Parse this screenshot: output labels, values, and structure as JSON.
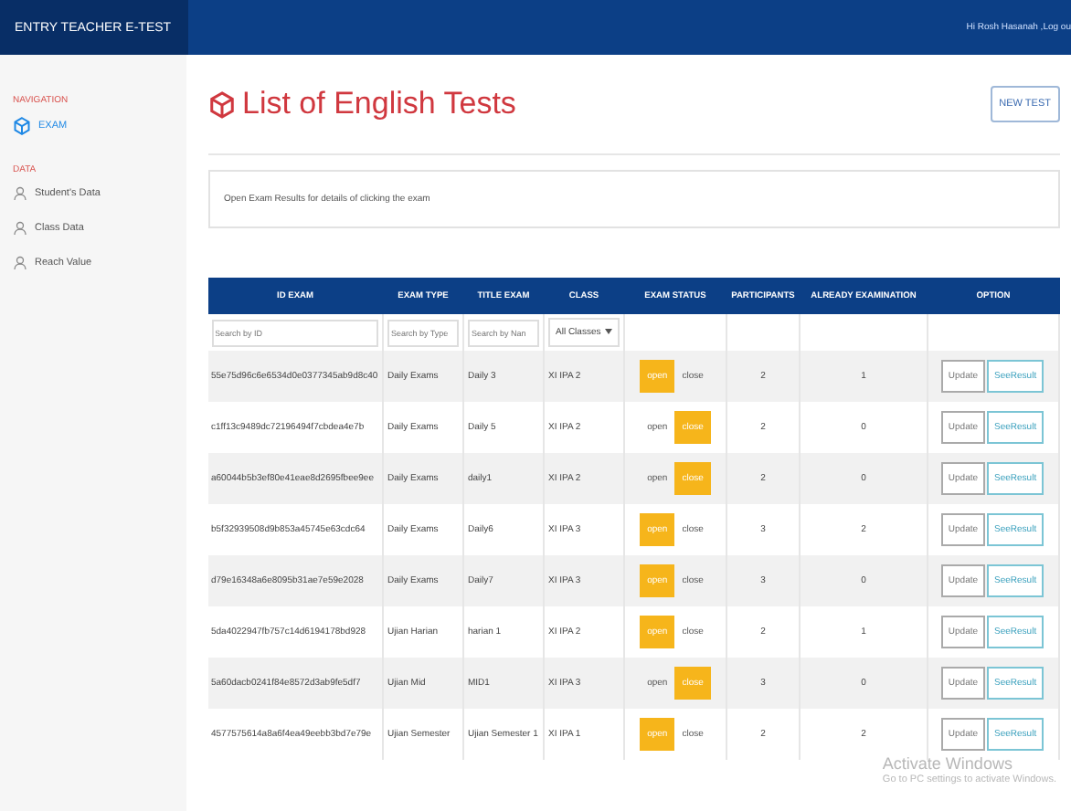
{
  "topbar": {
    "brand": "ENTRY TEACHER E-TEST",
    "user": "Hi Rosh Hasanah ,Log ou"
  },
  "sidebar": {
    "sections": [
      {
        "heading": "NAVIGATION",
        "items": [
          {
            "label": "EXAM",
            "kind": "exam",
            "selected": true
          }
        ]
      },
      {
        "heading": "DATA",
        "items": [
          {
            "label": "Student's Data",
            "kind": "person",
            "selected": false
          },
          {
            "label": "Class Data",
            "kind": "person",
            "selected": false
          },
          {
            "label": "Reach Value",
            "kind": "person",
            "selected": false
          }
        ]
      }
    ]
  },
  "page": {
    "title": "List of English Tests",
    "new_button": "NEW TEST",
    "info": "Open Exam Results for details of clicking the exam"
  },
  "table": {
    "columns": [
      "ID EXAM",
      "EXAM TYPE",
      "TITLE EXAM",
      "CLASS",
      "EXAM STATUS",
      "PARTICIPANTS",
      "ALREADY EXAMINATION",
      "OPTION"
    ],
    "filters": [
      {
        "kind": "input",
        "placeholder": "Search by ID"
      },
      {
        "kind": "input",
        "placeholder": "Search by Type"
      },
      {
        "kind": "input",
        "placeholder": "Search by Nan"
      },
      {
        "kind": "select",
        "value": "All Classes"
      }
    ],
    "rows": [
      {
        "id": "55e75d96c6e6534d0e0377345ab9d8c40",
        "type": "Daily Exams",
        "title": "Daily 3",
        "class": "XI IPA 2",
        "status": [
          {
            "label": "open",
            "selected": true
          },
          {
            "label": "close",
            "selected": false
          }
        ],
        "participants": "2",
        "already": "1",
        "buttons": [
          "Update",
          "SeeResult"
        ]
      },
      {
        "id": "c1ff13c9489dc72196494f7cbdea4e7b",
        "type": "Daily Exams",
        "title": "Daily 5",
        "class": "XI IPA 2",
        "status": [
          {
            "label": "open",
            "selected": false
          },
          {
            "label": "close",
            "selected": true
          }
        ],
        "participants": "2",
        "already": "0",
        "buttons": [
          "Update",
          "SeeResult"
        ]
      },
      {
        "id": "a60044b5b3ef80e41eae8d2695fbee9ee",
        "type": "Daily Exams",
        "title": "daily1",
        "class": "XI IPA 2",
        "status": [
          {
            "label": "open",
            "selected": false
          },
          {
            "label": "close",
            "selected": true
          }
        ],
        "participants": "2",
        "already": "0",
        "buttons": [
          "Update",
          "SeeResult"
        ]
      },
      {
        "id": "b5f32939508d9b853a45745e63cdc64",
        "type": "Daily Exams",
        "title": "Daily6",
        "class": "XI IPA 3",
        "status": [
          {
            "label": "open",
            "selected": true
          },
          {
            "label": "close",
            "selected": false
          }
        ],
        "participants": "3",
        "already": "2",
        "buttons": [
          "Update",
          "SeeResult"
        ]
      },
      {
        "id": "d79e16348a6e8095b31ae7e59e2028",
        "type": "Daily Exams",
        "title": "Daily7",
        "class": "XI IPA 3",
        "status": [
          {
            "label": "open",
            "selected": true
          },
          {
            "label": "close",
            "selected": false
          }
        ],
        "participants": "3",
        "already": "0",
        "buttons": [
          "Update",
          "SeeResult"
        ]
      },
      {
        "id": "5da4022947fb757c14d6194178bd928",
        "type": "Ujian Harian",
        "title": "harian 1",
        "class": "XI IPA 2",
        "status": [
          {
            "label": "open",
            "selected": true
          },
          {
            "label": "close",
            "selected": false
          }
        ],
        "participants": "2",
        "already": "1",
        "buttons": [
          "Update",
          "SeeResult"
        ]
      },
      {
        "id": "5a60dacb0241f84e8572d3ab9fe5df7",
        "type": "Ujian Mid",
        "title": "MID1",
        "class": "XI IPA 3",
        "status": [
          {
            "label": "open",
            "selected": false
          },
          {
            "label": "close",
            "selected": true
          }
        ],
        "participants": "3",
        "already": "0",
        "buttons": [
          "Update",
          "SeeResult"
        ]
      },
      {
        "id": "4577575614a8a6f4ea49eebb3bd7e79e",
        "type": "Ujian Semester",
        "title": "Ujian Semester 1",
        "class": "XI IPA 1",
        "status": [
          {
            "label": "open",
            "selected": true
          },
          {
            "label": "close",
            "selected": false
          }
        ],
        "participants": "2",
        "already": "2",
        "buttons": [
          "Update",
          "SeeResult"
        ]
      }
    ]
  },
  "os_notice": {
    "title": "Activate Windows",
    "detail": "Go to PC settings to activate Windows."
  }
}
